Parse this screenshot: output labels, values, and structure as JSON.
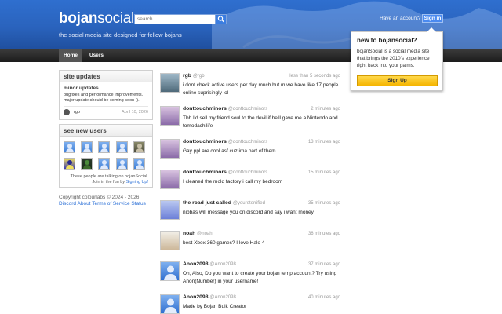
{
  "header": {
    "logo_bold": "bojan",
    "logo_rest": "social",
    "tagline": "the social media site designed for fellow bojans",
    "search_placeholder": "search...",
    "have_account": "Have an account?",
    "sign_in": "Sign in"
  },
  "nav": {
    "home": "Home",
    "users": "Users"
  },
  "popover": {
    "title": "new to bojansocial?",
    "body": "bojanSocial is a social media site that brings the 2010's experience right back into your palms.",
    "signup": "Sign Up"
  },
  "site_updates": {
    "heading": "site updates",
    "title": "minor updates",
    "body": "bugfixes and performance improvements. major update should be coming soon :).",
    "author": "rgb",
    "date": "April 10, 2026"
  },
  "new_users": {
    "heading": "see new users",
    "note_line1": "These people are talking on bojanSocial.",
    "note_line2": "Join in the fun by",
    "note_link": "Signing Up!"
  },
  "footer": {
    "copyright": "Copyright colourlabs © 2024 - 2026",
    "links": [
      "Discord",
      "About",
      "Terms of Service",
      "Status"
    ]
  },
  "posts": [
    {
      "name": "rgb",
      "handle": "@rgb",
      "time": "less than 5 seconds ago",
      "text": "i dont check active users per day much but m we have like 17 people online suprisingly lol"
    },
    {
      "name": "donttouchminors",
      "handle": "@donttouchminors",
      "time": "2 minutes ago",
      "text": "Tbh I'd sell my friend soul to the devil if he'll gave me a Nintendo and tomodachilife"
    },
    {
      "name": "donttouchminors",
      "handle": "@donttouchminors",
      "time": "13 minutes ago",
      "text": "Gay ppl are cool asf cuz ima part of them"
    },
    {
      "name": "donttouchminors",
      "handle": "@donttouchminors",
      "time": "15 minutes ago",
      "text": "I cleaned the mold factory i call my bedroom"
    },
    {
      "name": "the road just called",
      "handle": "@youreterrified",
      "time": "35 minutes ago",
      "text": "nibbas will message you on discord and say i want money"
    },
    {
      "name": "noah",
      "handle": "@noah",
      "time": "36 minutes ago",
      "text": "best Xbox 360 games? I love Halo 4"
    },
    {
      "name": "Anon2098",
      "handle": "@Anon2098",
      "time": "37 minutes ago",
      "text": "Oh, Also, Do you want to create your bojan temp account? Try using Anon{Number} in your username!"
    },
    {
      "name": "Anon2098",
      "handle": "@Anon2098",
      "time": "40 minutes ago",
      "text": "Made by Bojan Bulk Creator"
    }
  ],
  "colors": {
    "brand_blue": "#2a63bd",
    "nav_dark": "#1c1c1c",
    "signup_yellow": "#f5b400",
    "link_blue": "#2a6fd6"
  }
}
